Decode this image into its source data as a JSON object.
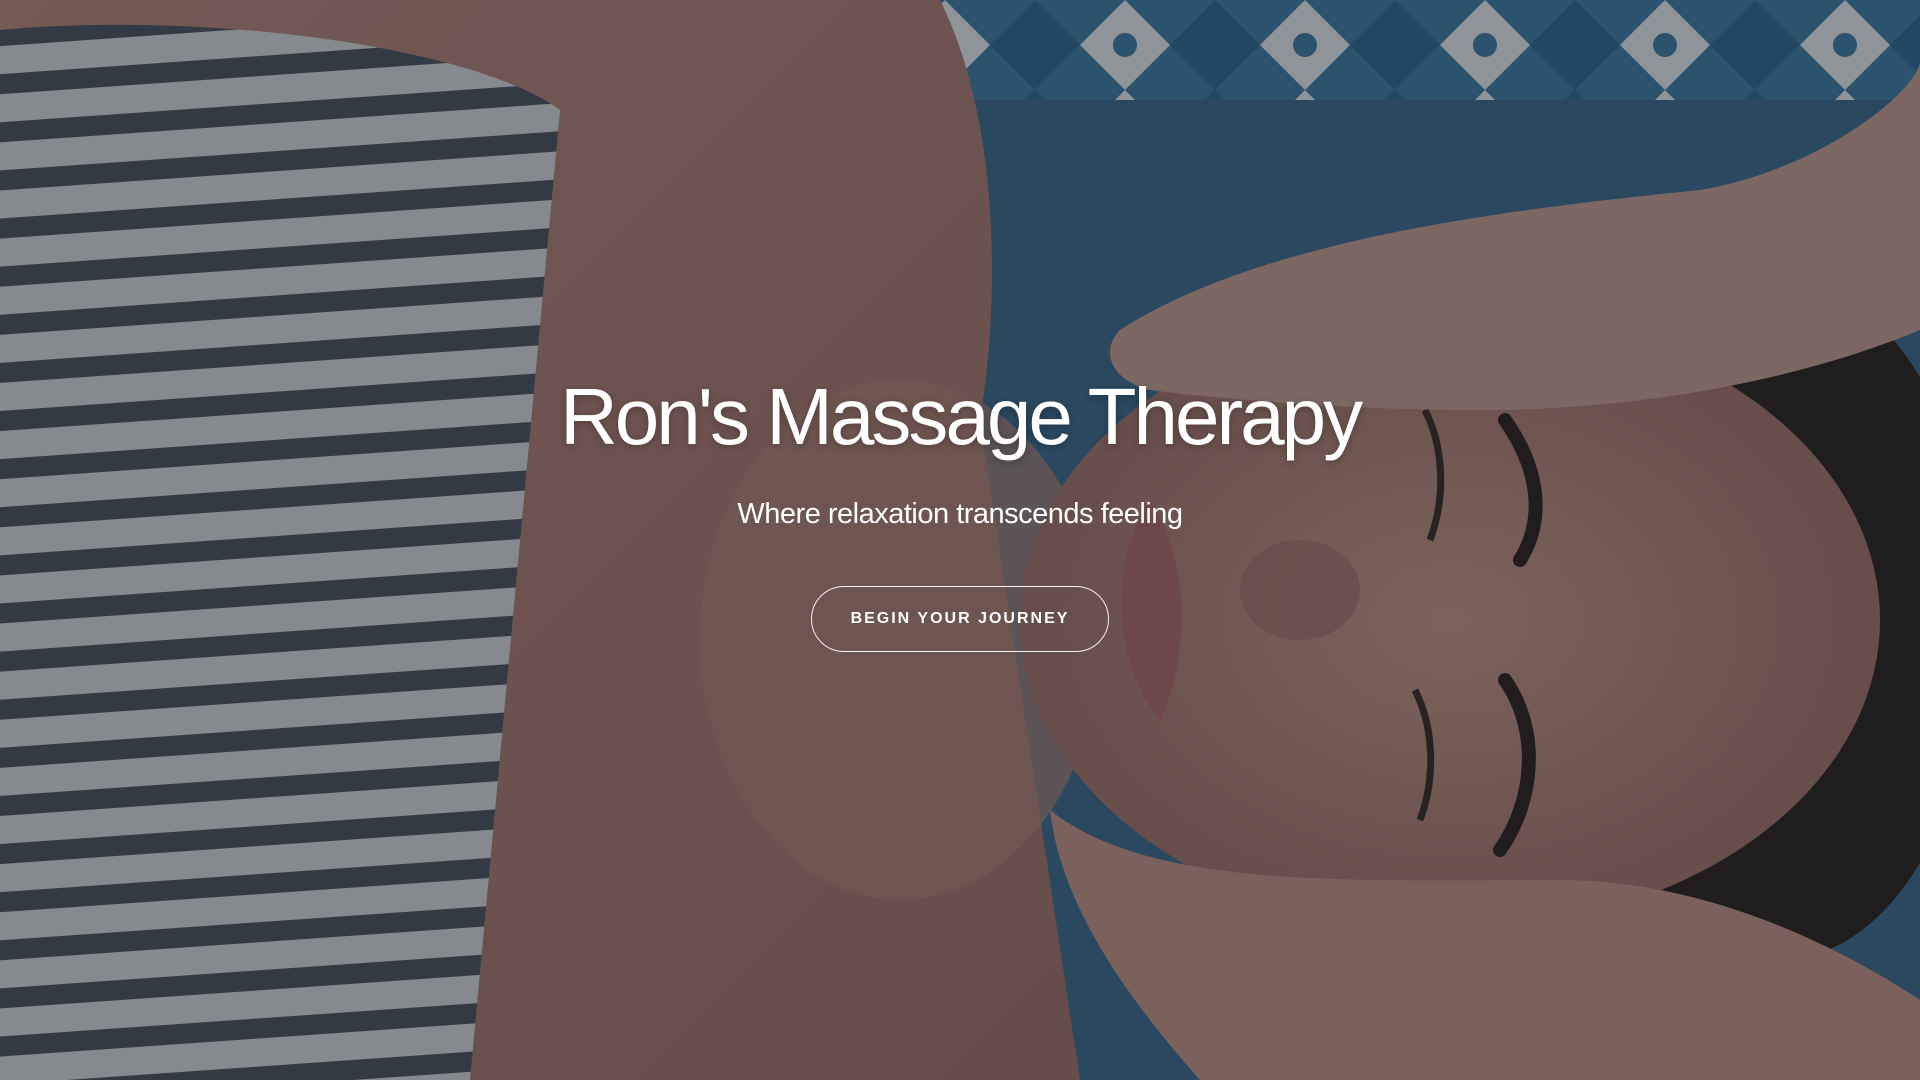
{
  "hero": {
    "title": "Ron's Massage Therapy",
    "tagline": "Where relaxation transcends feeling",
    "cta_label": "BEGIN YOUR JOURNEY",
    "background_image": "woman-receiving-facial-massage-photo"
  },
  "colors": {
    "overlay": "#141820",
    "text": "#ffffff",
    "cta_border": "#ffffff"
  }
}
